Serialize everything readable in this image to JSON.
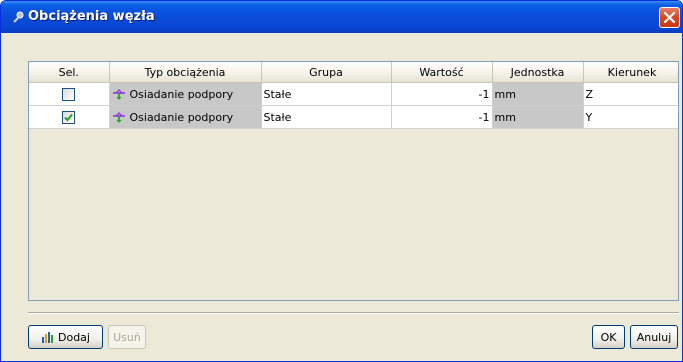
{
  "window": {
    "title": "Obciążenia węzła"
  },
  "table": {
    "columns": [
      "Sel.",
      "Typ obciążenia",
      "Grupa",
      "Wartość",
      "Jednostka",
      "Kierunek"
    ],
    "rows": [
      {
        "selected": false,
        "type": "Osiadanie podpory",
        "group": "Stałe",
        "value": "-1",
        "unit": "mm",
        "direction": "Z"
      },
      {
        "selected": true,
        "type": "Osiadanie podpory",
        "group": "Stałe",
        "value": "-1",
        "unit": "mm",
        "direction": "Y"
      }
    ]
  },
  "buttons": {
    "add": "Dodaj",
    "remove": "Usuń",
    "ok": "OK",
    "cancel": "Anuluj"
  },
  "icons": {
    "title": "pin-icon",
    "close": "close-icon",
    "row_type": "support-settlement-icon",
    "add": "chart-add-icon"
  },
  "colors": {
    "titlebar": "#0a4fdc",
    "close": "#d9461f",
    "checkmark": "#21a121",
    "typeIcon": "#8a2be2"
  }
}
